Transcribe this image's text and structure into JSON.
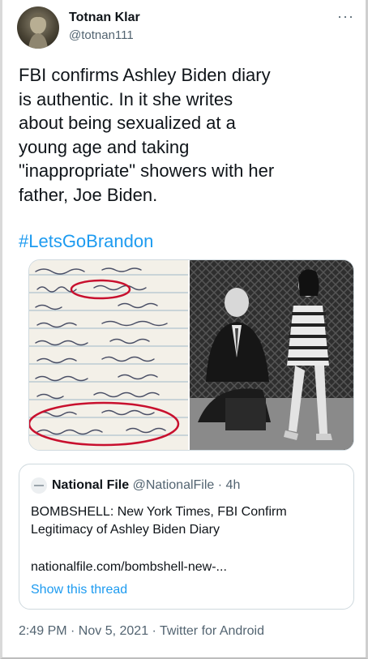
{
  "author": {
    "name": "Totnan Klar",
    "handle": "@totnan111",
    "more_label": "···"
  },
  "tweet": {
    "text": "FBI confirms Ashley Biden diary\nis authentic. In it she writes\nabout being sexualized at a\nyoung age and taking\n\"inappropriate\" showers with her\nfather, Joe Biden.",
    "hashtag": "#LetsGoBrandon"
  },
  "media": {
    "left_image_icon": "handwritten-diary-page",
    "right_image_icon": "black-and-white-photo-man-and-girl"
  },
  "quote": {
    "name": "National File",
    "handle": "@NationalFile",
    "time": "· 4h",
    "text": "BOMBSHELL: New York Times, FBI Confirm\nLegitimacy of Ashley Biden Diary",
    "link": "nationalfile.com/bombshell-new-...",
    "show_thread": "Show this thread"
  },
  "footer": {
    "meta": "2:49 PM · Nov 5, 2021 · Twitter for Android"
  },
  "colors": {
    "link": "#1d9bf0",
    "muted": "#536471",
    "circle_annotation": "#c8102e"
  }
}
